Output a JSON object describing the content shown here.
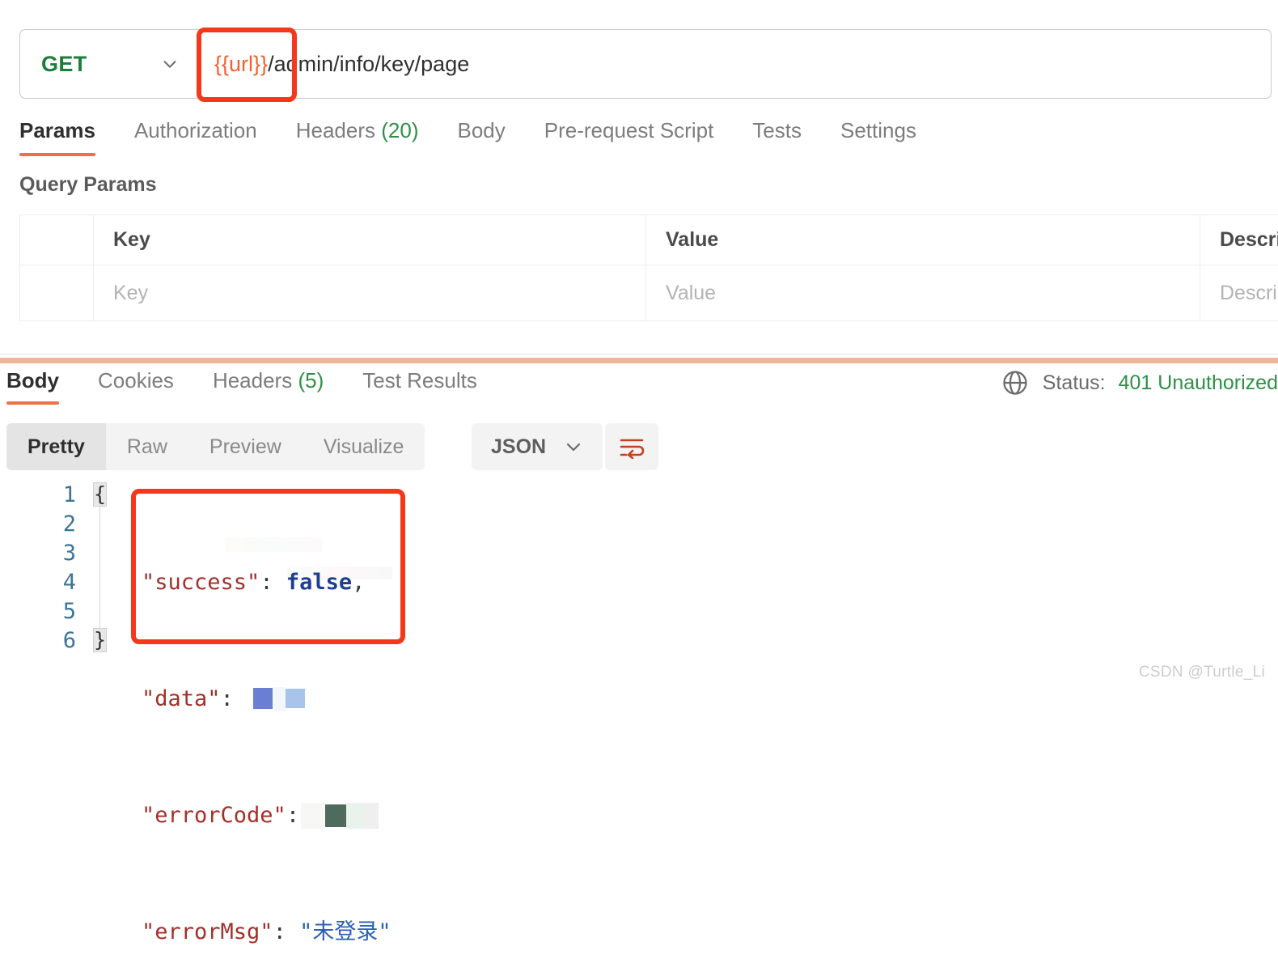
{
  "request": {
    "method": "GET",
    "method_color": "#1a7f37",
    "url_variable": "{{url}}",
    "url_path": "/admin/info/key/page",
    "tabs": [
      {
        "label": "Params",
        "count": "",
        "active": true
      },
      {
        "label": "Authorization",
        "count": "",
        "active": false
      },
      {
        "label": "Headers",
        "count": "(20)",
        "active": false
      },
      {
        "label": "Body",
        "count": "",
        "active": false
      },
      {
        "label": "Pre-request Script",
        "count": "",
        "active": false
      },
      {
        "label": "Tests",
        "count": "",
        "active": false
      },
      {
        "label": "Settings",
        "count": "",
        "active": false
      }
    ],
    "query_params": {
      "title": "Query Params",
      "headers": [
        "",
        "Key",
        "Value",
        "Description"
      ],
      "rows": [
        {
          "check": "",
          "key": "Key",
          "value": "Value",
          "description": "Description"
        }
      ]
    }
  },
  "response": {
    "tabs": [
      {
        "label": "Body",
        "count": "",
        "active": true
      },
      {
        "label": "Cookies",
        "count": "",
        "active": false
      },
      {
        "label": "Headers",
        "count": "(5)",
        "active": false
      },
      {
        "label": "Test Results",
        "count": "",
        "active": false
      }
    ],
    "status_label": "Status:",
    "status_value": "401 Unauthorized",
    "status_color": "#2f8f46",
    "globe_icon": "globe-icon",
    "view_modes": [
      {
        "label": "Pretty",
        "active": true
      },
      {
        "label": "Raw",
        "active": false
      },
      {
        "label": "Preview",
        "active": false
      },
      {
        "label": "Visualize",
        "active": false
      }
    ],
    "format": "JSON",
    "wrap_icon": "word-wrap-icon",
    "body": {
      "line_numbers": [
        "1",
        "2",
        "3",
        "4",
        "5",
        "6"
      ],
      "open_brace": "{",
      "close_brace": "}",
      "lines": [
        {
          "key": "\"success\"",
          "colon": ": ",
          "value": "false",
          "value_type": "boolean",
          "comma": ","
        },
        {
          "key": "\"data\"",
          "colon": ": ",
          "value": "",
          "value_type": "redacted",
          "comma": ""
        },
        {
          "key": "\"errorCode\"",
          "colon": ":",
          "value": "",
          "value_type": "redacted",
          "comma": ""
        },
        {
          "key": "\"errorMsg\"",
          "colon": ": ",
          "value": "\"未登录\"",
          "value_type": "string",
          "comma": ""
        }
      ]
    }
  },
  "annotations": {
    "color": "#f4391a",
    "boxes": [
      "url-variable-highlight",
      "json-body-highlight"
    ]
  },
  "watermark": "CSDN @Turtle_Li"
}
